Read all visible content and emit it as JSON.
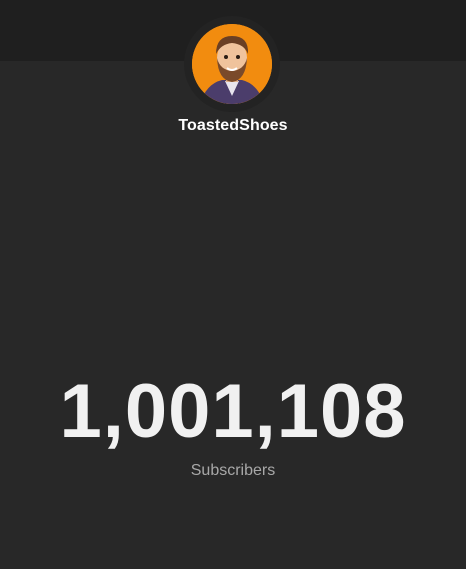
{
  "channel": {
    "name": "ToastedShoes",
    "avatar_icon": "bearded-man-avatar-icon"
  },
  "stats": {
    "subscriber_count": "1,001,108",
    "subscriber_label": "Subscribers"
  },
  "colors": {
    "background": "#282828",
    "top_bar": "#1f1f1f",
    "avatar_background": "#f28c0f",
    "count_text": "#f1f1f1",
    "label_text": "#a8a8a8"
  }
}
